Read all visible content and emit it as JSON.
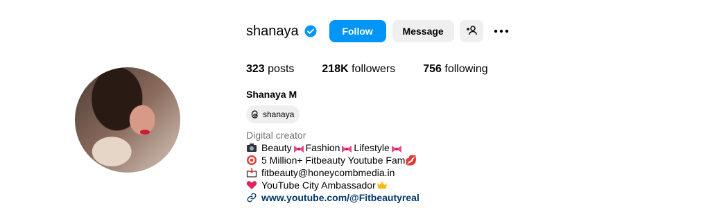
{
  "profile": {
    "username": "shanaya",
    "follow_label": "Follow",
    "message_label": "Message",
    "stats": {
      "posts_count": "323",
      "posts_label": "posts",
      "followers_count": "218K",
      "followers_label": "followers",
      "following_count": "756",
      "following_label": "following"
    },
    "full_name": "Shanaya M",
    "threads_handle": "shanaya",
    "category": "Digital creator",
    "bio": {
      "line1_a": "Beauty",
      "line1_b": "Fashion",
      "line1_c": "Lifestyle",
      "line2": "5 Million+ Fitbeauty Youtube Fam💋",
      "line3": "fitbeauty@honeycombmedia.in",
      "line4": "YouTube City Ambassador",
      "link": "www.youtube.com/@Fitbeautyreal"
    }
  },
  "icons": {
    "verified": "verified-badge-icon",
    "add_user": "add-user-icon",
    "more": "more-options-icon",
    "threads": "threads-icon",
    "link": "link-icon"
  },
  "colors": {
    "accent": "#0095f6",
    "secondary_button": "#efefef",
    "link": "#00376b",
    "muted": "#737373"
  }
}
